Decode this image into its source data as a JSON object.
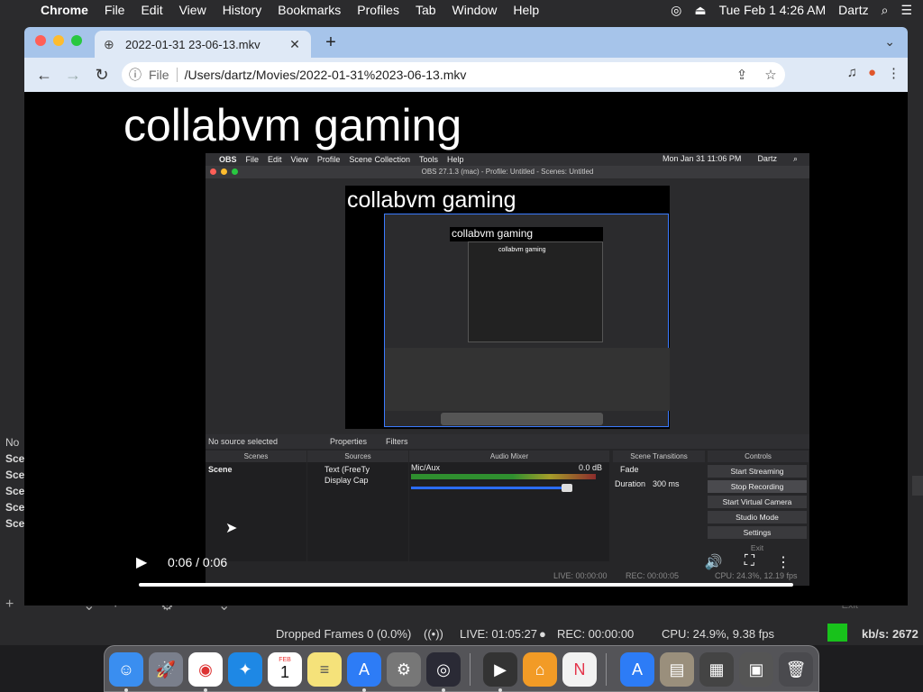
{
  "menubar": {
    "app": "Chrome",
    "items": [
      "File",
      "Edit",
      "View",
      "History",
      "Bookmarks",
      "Profiles",
      "Tab",
      "Window",
      "Help"
    ],
    "datetime": "Tue Feb 1  4:26 AM",
    "user": "Dartz"
  },
  "chrome": {
    "tab_title": "2022-01-31 23-06-13.mkv",
    "scheme": "File",
    "url": "/Users/dartz/Movies/2022-01-31%2023-06-13.mkv"
  },
  "video": {
    "caption": "collabvm gaming",
    "time": "0:06 / 0:06",
    "progress": 1.0
  },
  "obs_frame": {
    "menubar": {
      "app": "OBS",
      "items": [
        "File",
        "Edit",
        "View",
        "Profile",
        "Scene Collection",
        "Tools",
        "Help"
      ],
      "datetime": "Mon Jan 31  11:06 PM",
      "user": "Dartz"
    },
    "title": "OBS 27.1.3 (mac) - Profile: Untitled - Scenes: Untitled",
    "preview_caption": "collabvm gaming",
    "nested_caption": "collabvm gaming",
    "deep_caption": "collabvm gaming",
    "no_source": "No source selected",
    "properties": "Properties",
    "filters": "Filters",
    "docks": {
      "scenes": "Scenes",
      "sources": "Sources",
      "mixer": "Audio Mixer",
      "transitions": "Scene Transitions",
      "controls": "Controls"
    },
    "scene_item": "Scene",
    "source_items": [
      "Text (FreeTy",
      "Display Cap"
    ],
    "mixer_channel": "Mic/Aux",
    "mixer_db": "0.0 dB",
    "transition": "Fade",
    "duration_label": "Duration",
    "duration_value": "300 ms",
    "controls": [
      "Start Streaming",
      "Stop Recording",
      "Start Virtual Camera",
      "Studio Mode",
      "Settings",
      "Exit"
    ],
    "live": "LIVE: 00:00:00",
    "rec": "REC: 00:00:05",
    "cpu": "CPU: 24.3%, 12.19 fps"
  },
  "obs_bg": {
    "no_source": "No",
    "scene_items": [
      "Sce",
      "Sce",
      "Sce",
      "Sce",
      "Sce"
    ],
    "exit": "Exit"
  },
  "statusbar": {
    "dropped": "Dropped Frames 0 (0.0%)",
    "live": "LIVE: 01:05:27",
    "rec": "REC: 00:00:00",
    "cpu": "CPU: 24.9%, 9.38 fps",
    "kbps": "kb/s: 2672",
    "green": "#18c21b"
  },
  "dock": {
    "apps": [
      "finder-icon",
      "launchpad-icon",
      "chrome-icon",
      "safari-icon",
      "calendar-icon",
      "notes-icon",
      "app-store-icon",
      "system-preferences-icon",
      "obs-icon",
      "quicktime-icon",
      "home-icon",
      "news-icon",
      "app-store-2-icon",
      "downloads-icon",
      "folder-icon",
      "window-icon",
      "trash-icon"
    ],
    "calendar_day": "1",
    "calendar_month": "FEB"
  }
}
